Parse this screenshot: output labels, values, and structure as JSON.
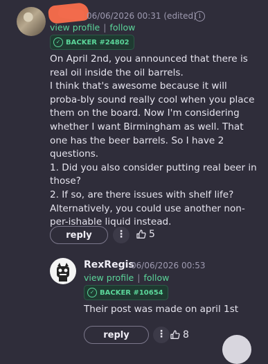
{
  "comment": {
    "timestamp": "06/06/2026 00:31 (edited)",
    "links": {
      "view_profile": "view profile",
      "separator": "|",
      "follow": "follow"
    },
    "badge": "BACKER #24802",
    "body_paragraphs": [
      "On April 2nd, you announced that there is real oil inside the oil barrels.",
      "I think that's awesome because it will proba-bly sound really cool when you place them on the board. Now I'm considering whether I want Birmingham as well. That one has the beer barrels. So I have 2 questions.",
      "1. Did you also consider putting real beer in those?",
      "2. If so, are there issues with shelf life? Alternatively, you could use another non-per-ishable liquid instead."
    ],
    "actions": {
      "reply": "reply",
      "more": "⋮",
      "likes": "5"
    }
  },
  "reply_comment": {
    "username": "RexRegis",
    "timestamp": "06/06/2026 00:53",
    "links": {
      "view_profile": "view profile",
      "separator": "|",
      "follow": "follow"
    },
    "badge": "BACKER #10654",
    "body": "Their post was made on april 1st",
    "actions": {
      "reply": "reply",
      "more": "⋮",
      "likes": "8"
    }
  },
  "colors": {
    "background": "#2f2d3a",
    "accent_green": "#5bd69a",
    "redaction": "#ef6a4a"
  },
  "icons": [
    "info-icon",
    "thumbs-up-icon",
    "more-vertical-icon",
    "badge-icon"
  ]
}
